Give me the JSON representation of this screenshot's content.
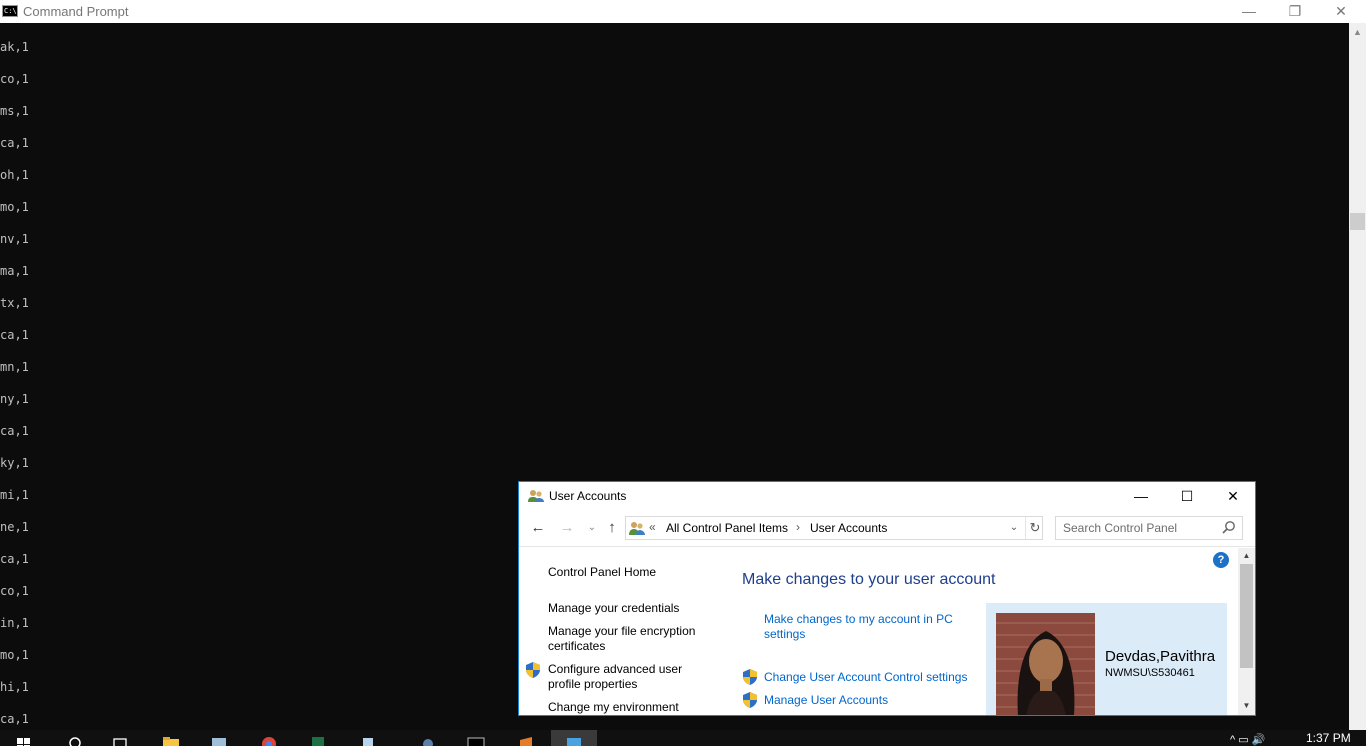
{
  "cmd": {
    "title": "Command Prompt",
    "lines": [
      "ak,1",
      "co,1",
      "ms,1",
      "ca,1",
      "oh,1",
      "mo,1",
      "nv,1",
      "ma,1",
      "tx,1",
      "ca,1",
      "mn,1",
      "ny,1",
      "ca,1",
      "ky,1",
      "mi,1",
      "ne,1",
      "ca,1",
      "co,1",
      "in,1",
      "mo,1",
      "hi,1",
      "ca,1"
    ],
    "controls": {
      "minimize": "—",
      "restore": "❐",
      "close": "✕"
    }
  },
  "user_accounts": {
    "title": "User Accounts",
    "controls": {
      "minimize": "—",
      "maximize": "☐",
      "close": "✕"
    },
    "nav": {
      "back": "←",
      "forward": "→",
      "recent": "⌄",
      "up": "↑"
    },
    "address": {
      "chevrons": "«",
      "crumbs": [
        "All Control Panel Items",
        "User Accounts"
      ],
      "separator": "›",
      "dropdown": "⌄",
      "refresh": "↻"
    },
    "search": {
      "placeholder": "Search Control Panel"
    },
    "left_links": [
      "Control Panel Home",
      "Manage your credentials",
      "Manage your file encryption certificates",
      "Configure advanced user profile properties",
      "Change my environment"
    ],
    "help": "?",
    "heading": "Make changes to your user account",
    "main_links": [
      "Make changes to my account in PC settings",
      "Change User Account Control settings",
      "Manage User Accounts"
    ],
    "account": {
      "name": "Devdas,Pavithra",
      "domain": "NWMSU\\S530461"
    },
    "scrollbar": {
      "up": "▲",
      "down": "▼"
    }
  },
  "taskbar": {
    "items": [
      "start",
      "search",
      "task-view",
      "file-explorer",
      "network-drive",
      "chrome",
      "excel",
      "notepad",
      "settings",
      "command-prompt",
      "visual-studio",
      "control-panel"
    ],
    "clock": "1:37 PM",
    "tray": "^ ▭ 🔊"
  },
  "colors": {
    "accent": "#1883d7",
    "link": "#0066cc",
    "heading": "#1e3f8c",
    "console_text": "#c0c0c0",
    "console_bg": "#0c0c0c"
  }
}
